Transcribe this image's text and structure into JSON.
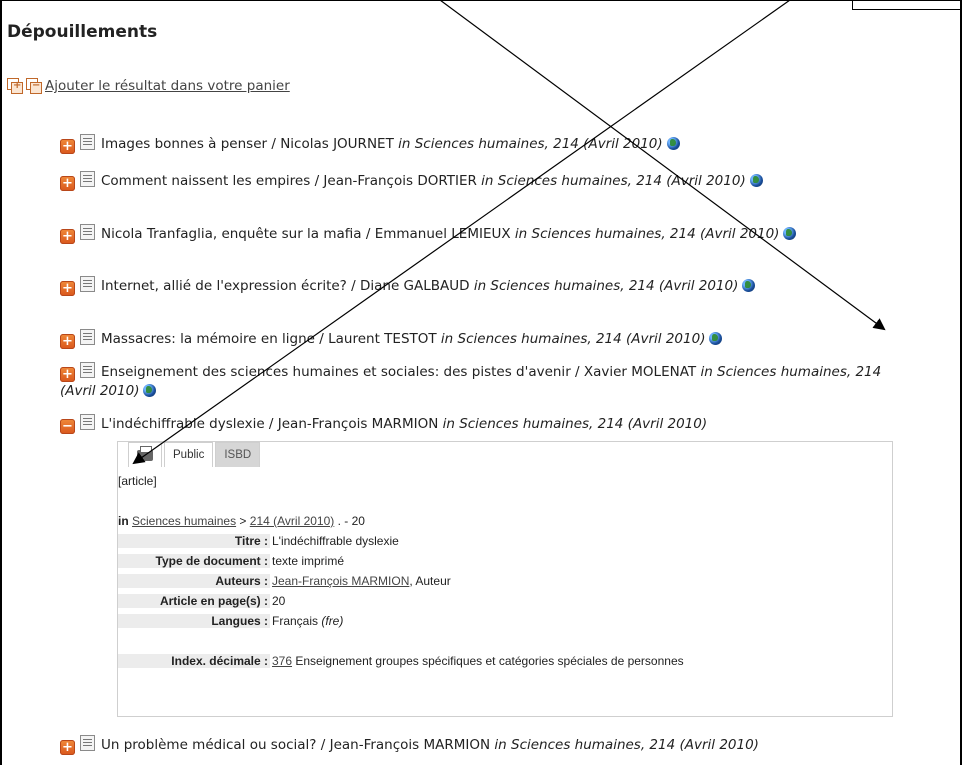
{
  "section_title": "Dépouillements",
  "cart_link": "Ajouter le résultat dans votre panier",
  "entries": [
    {
      "text": "Images bonnes à penser / Nicolas JOURNET ",
      "source": "in Sciences humaines, 214 (Avril 2010)",
      "globe": true
    },
    {
      "text": "Comment naissent les empires / Jean-François DORTIER ",
      "source": "in Sciences humaines, 214 (Avril 2010)",
      "globe": true
    },
    {
      "text": "Nicola Tranfaglia, enquête sur la mafia / Emmanuel LEMIEUX ",
      "source": "in Sciences humaines, 214 (Avril 2010)",
      "globe": true
    },
    {
      "text": "Internet, allié de l'expression écrite? / Diane GALBAUD ",
      "source": "in Sciences humaines, 214 (Avril 2010)",
      "globe": true
    },
    {
      "text": "Massacres: la mémoire en ligne / Laurent TESTOT ",
      "source": "in Sciences humaines, 214 (Avril 2010)",
      "globe": true
    },
    {
      "text": "Enseignement des sciences humaines et sociales: des pistes d'avenir / Xavier MOLENAT ",
      "source": "in Sciences humaines, 214 (Avril 2010)",
      "globe": true
    },
    {
      "text": "L'indéchiffrable dyslexie / Jean-François MARMION ",
      "source": "in Sciences humaines, 214 (Avril 2010)",
      "globe": false
    },
    {
      "text": "Un problème médical ou social? / Jean-François MARMION ",
      "source": "in Sciences humaines, 214 (Avril 2010)",
      "globe": false
    }
  ],
  "detail": {
    "tabs": {
      "public": "Public",
      "isbd": "ISBD"
    },
    "type_tag": "[article]",
    "in_prefix": "in",
    "journal_link": "Sciences humaines",
    "separator": ">",
    "issue_link": "214 (Avril 2010)",
    "pages_suffix": ". - 20",
    "fields": [
      {
        "label": "Titre :",
        "value": "L'indéchiffrable dyslexie"
      },
      {
        "label": "Type de document :",
        "value": "texte imprimé"
      },
      {
        "label": "Auteurs :",
        "value_link": "Jean-François MARMION",
        "value": ", Auteur"
      },
      {
        "label": "Article en page(s) :",
        "value": "20"
      },
      {
        "label": "Langues :",
        "value": "Français ",
        "value_italic": "(fre)"
      }
    ],
    "index": {
      "label": "Index. décimale :",
      "code_link": "376",
      "text": "Enseignement groupes spécifiques et catégories spéciales de personnes"
    }
  },
  "colors": {
    "accent_orange": "#e06a2a",
    "link": "#444444",
    "label_bg": "#ececec"
  }
}
